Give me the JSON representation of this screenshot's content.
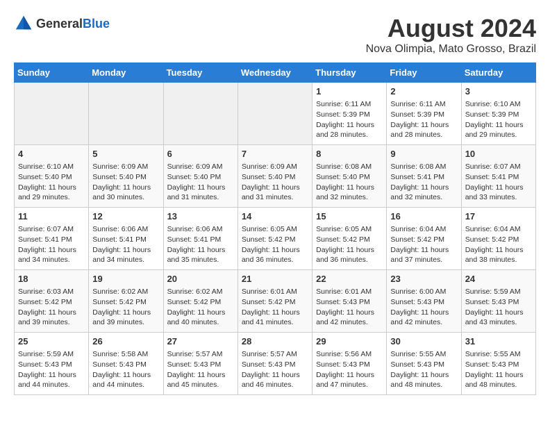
{
  "logo": {
    "general": "General",
    "blue": "Blue"
  },
  "title": "August 2024",
  "location": "Nova Olimpia, Mato Grosso, Brazil",
  "days_of_week": [
    "Sunday",
    "Monday",
    "Tuesday",
    "Wednesday",
    "Thursday",
    "Friday",
    "Saturday"
  ],
  "weeks": [
    [
      {
        "day": "",
        "info": ""
      },
      {
        "day": "",
        "info": ""
      },
      {
        "day": "",
        "info": ""
      },
      {
        "day": "",
        "info": ""
      },
      {
        "day": "1",
        "info": "Sunrise: 6:11 AM\nSunset: 5:39 PM\nDaylight: 11 hours and 28 minutes."
      },
      {
        "day": "2",
        "info": "Sunrise: 6:11 AM\nSunset: 5:39 PM\nDaylight: 11 hours and 28 minutes."
      },
      {
        "day": "3",
        "info": "Sunrise: 6:10 AM\nSunset: 5:39 PM\nDaylight: 11 hours and 29 minutes."
      }
    ],
    [
      {
        "day": "4",
        "info": "Sunrise: 6:10 AM\nSunset: 5:40 PM\nDaylight: 11 hours and 29 minutes."
      },
      {
        "day": "5",
        "info": "Sunrise: 6:09 AM\nSunset: 5:40 PM\nDaylight: 11 hours and 30 minutes."
      },
      {
        "day": "6",
        "info": "Sunrise: 6:09 AM\nSunset: 5:40 PM\nDaylight: 11 hours and 31 minutes."
      },
      {
        "day": "7",
        "info": "Sunrise: 6:09 AM\nSunset: 5:40 PM\nDaylight: 11 hours and 31 minutes."
      },
      {
        "day": "8",
        "info": "Sunrise: 6:08 AM\nSunset: 5:40 PM\nDaylight: 11 hours and 32 minutes."
      },
      {
        "day": "9",
        "info": "Sunrise: 6:08 AM\nSunset: 5:41 PM\nDaylight: 11 hours and 32 minutes."
      },
      {
        "day": "10",
        "info": "Sunrise: 6:07 AM\nSunset: 5:41 PM\nDaylight: 11 hours and 33 minutes."
      }
    ],
    [
      {
        "day": "11",
        "info": "Sunrise: 6:07 AM\nSunset: 5:41 PM\nDaylight: 11 hours and 34 minutes."
      },
      {
        "day": "12",
        "info": "Sunrise: 6:06 AM\nSunset: 5:41 PM\nDaylight: 11 hours and 34 minutes."
      },
      {
        "day": "13",
        "info": "Sunrise: 6:06 AM\nSunset: 5:41 PM\nDaylight: 11 hours and 35 minutes."
      },
      {
        "day": "14",
        "info": "Sunrise: 6:05 AM\nSunset: 5:42 PM\nDaylight: 11 hours and 36 minutes."
      },
      {
        "day": "15",
        "info": "Sunrise: 6:05 AM\nSunset: 5:42 PM\nDaylight: 11 hours and 36 minutes."
      },
      {
        "day": "16",
        "info": "Sunrise: 6:04 AM\nSunset: 5:42 PM\nDaylight: 11 hours and 37 minutes."
      },
      {
        "day": "17",
        "info": "Sunrise: 6:04 AM\nSunset: 5:42 PM\nDaylight: 11 hours and 38 minutes."
      }
    ],
    [
      {
        "day": "18",
        "info": "Sunrise: 6:03 AM\nSunset: 5:42 PM\nDaylight: 11 hours and 39 minutes."
      },
      {
        "day": "19",
        "info": "Sunrise: 6:02 AM\nSunset: 5:42 PM\nDaylight: 11 hours and 39 minutes."
      },
      {
        "day": "20",
        "info": "Sunrise: 6:02 AM\nSunset: 5:42 PM\nDaylight: 11 hours and 40 minutes."
      },
      {
        "day": "21",
        "info": "Sunrise: 6:01 AM\nSunset: 5:42 PM\nDaylight: 11 hours and 41 minutes."
      },
      {
        "day": "22",
        "info": "Sunrise: 6:01 AM\nSunset: 5:43 PM\nDaylight: 11 hours and 42 minutes."
      },
      {
        "day": "23",
        "info": "Sunrise: 6:00 AM\nSunset: 5:43 PM\nDaylight: 11 hours and 42 minutes."
      },
      {
        "day": "24",
        "info": "Sunrise: 5:59 AM\nSunset: 5:43 PM\nDaylight: 11 hours and 43 minutes."
      }
    ],
    [
      {
        "day": "25",
        "info": "Sunrise: 5:59 AM\nSunset: 5:43 PM\nDaylight: 11 hours and 44 minutes."
      },
      {
        "day": "26",
        "info": "Sunrise: 5:58 AM\nSunset: 5:43 PM\nDaylight: 11 hours and 44 minutes."
      },
      {
        "day": "27",
        "info": "Sunrise: 5:57 AM\nSunset: 5:43 PM\nDaylight: 11 hours and 45 minutes."
      },
      {
        "day": "28",
        "info": "Sunrise: 5:57 AM\nSunset: 5:43 PM\nDaylight: 11 hours and 46 minutes."
      },
      {
        "day": "29",
        "info": "Sunrise: 5:56 AM\nSunset: 5:43 PM\nDaylight: 11 hours and 47 minutes."
      },
      {
        "day": "30",
        "info": "Sunrise: 5:55 AM\nSunset: 5:43 PM\nDaylight: 11 hours and 48 minutes."
      },
      {
        "day": "31",
        "info": "Sunrise: 5:55 AM\nSunset: 5:43 PM\nDaylight: 11 hours and 48 minutes."
      }
    ]
  ]
}
